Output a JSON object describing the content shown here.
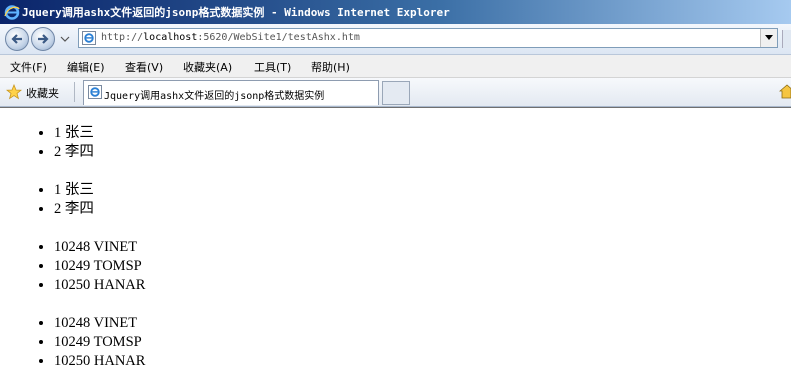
{
  "window": {
    "title": "Jquery调用ashx文件返回的jsonp格式数据实例 - Windows Internet Explorer"
  },
  "address_bar": {
    "url_prefix": "http://",
    "url_host": "localhost",
    "url_rest": ":5620/WebSite1/testAshx.htm"
  },
  "menu": {
    "items": [
      "文件(F)",
      "编辑(E)",
      "查看(V)",
      "收藏夹(A)",
      "工具(T)",
      "帮助(H)"
    ]
  },
  "favorites": {
    "label": "收藏夹"
  },
  "tab": {
    "title": "Jquery调用ashx文件返回的jsonp格式数据实例"
  },
  "content": {
    "lists": [
      [
        "1 张三",
        "2 李四"
      ],
      [
        "1 张三",
        "2 李四"
      ],
      [
        "10248 VINET",
        "10249 TOMSP",
        "10250 HANAR"
      ],
      [
        "10248 VINET",
        "10249 TOMSP",
        "10250 HANAR"
      ]
    ]
  },
  "colors": {
    "title_bar_start": "#0a246a",
    "title_bar_end": "#a6caf0",
    "ie_icon": "#2a7fd4"
  }
}
